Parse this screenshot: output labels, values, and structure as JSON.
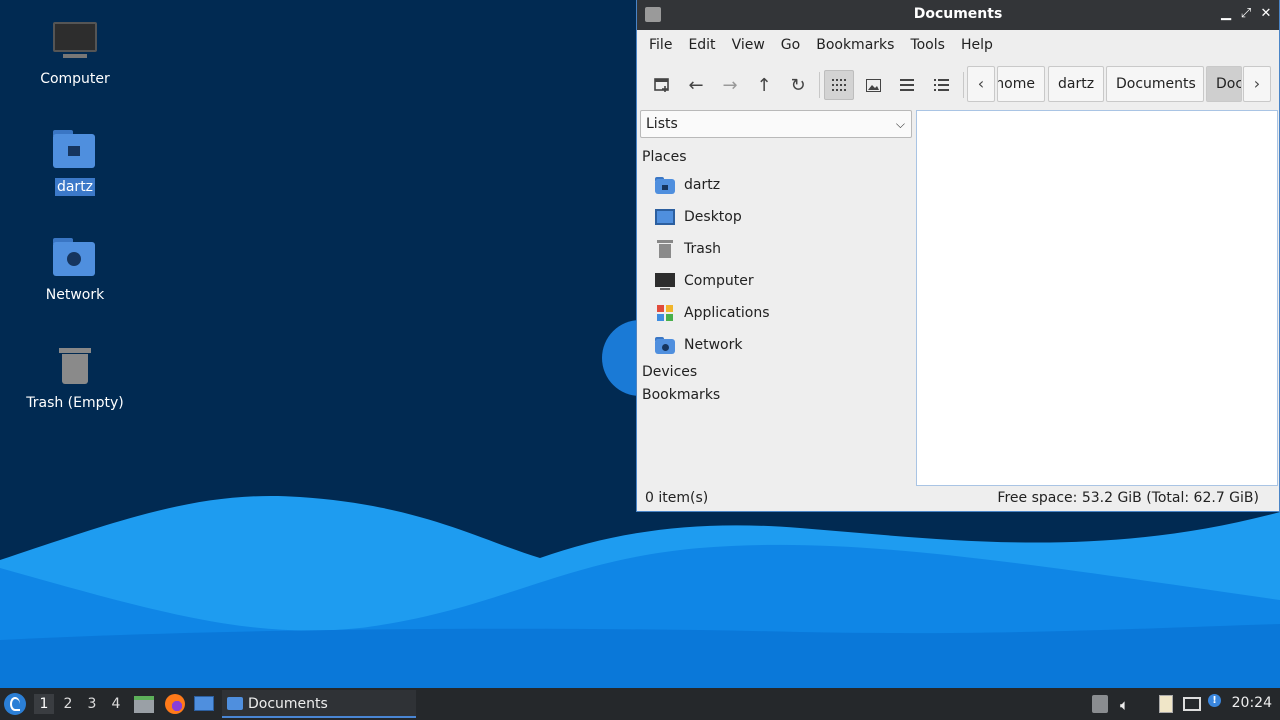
{
  "desktop": {
    "icons": [
      {
        "label": "Computer",
        "icon": "computer-icon"
      },
      {
        "label": "dartz",
        "icon": "home-folder-icon"
      },
      {
        "label": "Network",
        "icon": "network-folder-icon"
      },
      {
        "label": "Trash (Empty)",
        "icon": "trash-icon"
      }
    ],
    "colors": {
      "wallpaper_dark": "#012a52",
      "wave_light": "#1e9cf0",
      "wave_mid": "#0c7fe0"
    }
  },
  "window": {
    "title": "Documents",
    "controls": {
      "minimize": "▁",
      "maximize": "⤢",
      "close": "✕"
    },
    "menu": [
      "File",
      "Edit",
      "View",
      "Go",
      "Bookmarks",
      "Tools",
      "Help"
    ],
    "breadcrumbs": [
      "home",
      "dartz",
      "Documents",
      "Doc"
    ],
    "sidepane": {
      "selector": "Lists",
      "sections": {
        "places": "Places",
        "devices": "Devices",
        "bookmarks": "Bookmarks"
      },
      "places": [
        {
          "label": "dartz",
          "icon": "home-folder-icon"
        },
        {
          "label": "Desktop",
          "icon": "desktop-icon"
        },
        {
          "label": "Trash",
          "icon": "trash-icon"
        },
        {
          "label": "Computer",
          "icon": "computer-icon"
        },
        {
          "label": "Applications",
          "icon": "applications-icon"
        },
        {
          "label": "Network",
          "icon": "network-folder-icon"
        }
      ]
    },
    "status": {
      "items": "0 item(s)",
      "space": "Free space: 53.2 GiB (Total: 62.7 GiB)"
    }
  },
  "taskbar": {
    "workspaces": [
      "1",
      "2",
      "3",
      "4"
    ],
    "active_workspace": "1",
    "task": "Documents",
    "clock": "20:24",
    "accent": "#4a86d4"
  }
}
